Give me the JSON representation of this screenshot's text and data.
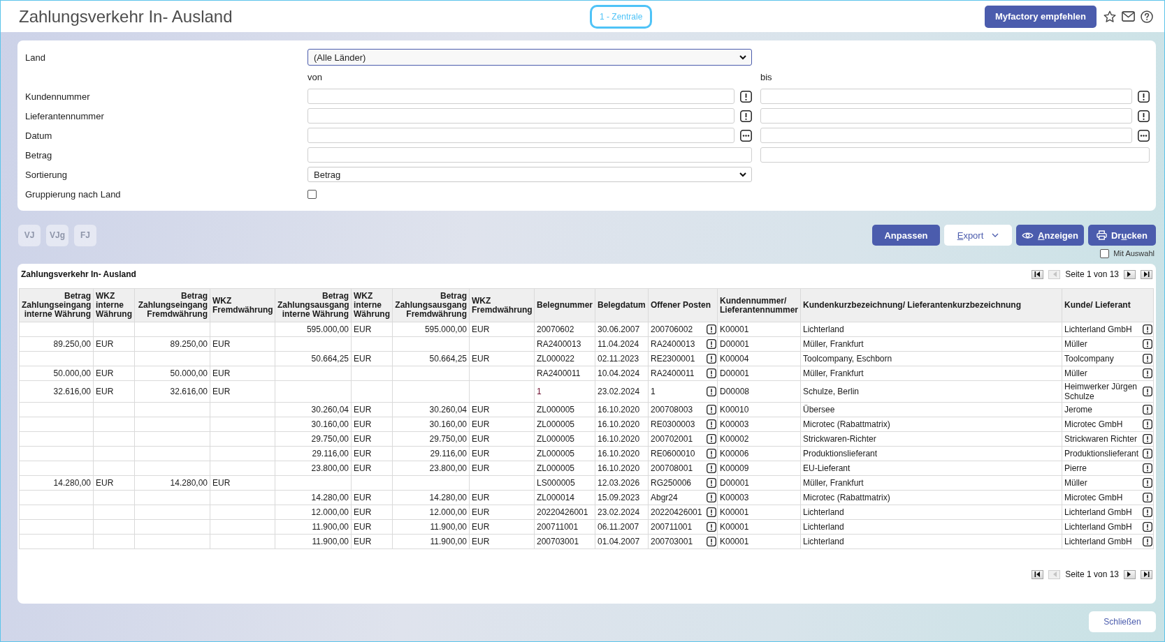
{
  "header": {
    "title": "Zahlungsverkehr In- Ausland",
    "company": "1 - Zentrale",
    "recommend_button": "Myfactory empfehlen"
  },
  "filter": {
    "land": {
      "label": "Land",
      "value": "(Alle Länder)",
      "focused": true
    },
    "range_labels": {
      "from": "von",
      "to": "bis"
    },
    "ranges": [
      {
        "label": "Kundennummer",
        "kind": "lookup"
      },
      {
        "label": "Lieferantennummer",
        "kind": "lookup"
      },
      {
        "label": "Datum",
        "kind": "date"
      },
      {
        "label": "Betrag",
        "kind": "plain"
      }
    ],
    "sort": {
      "label": "Sortierung",
      "value": "Betrag",
      "focused": false
    },
    "grouping": {
      "label": "Gruppierung nach Land",
      "checked": false
    }
  },
  "toolbar": {
    "period_buttons": [
      {
        "label": "VJ",
        "disabled": true
      },
      {
        "label": "VJg",
        "disabled": true
      },
      {
        "label": "FJ",
        "disabled": true
      }
    ],
    "actions": [
      {
        "kind": "primary",
        "label": [
          {
            "text": "Anpassen",
            "underlined": false
          }
        ]
      },
      {
        "kind": "menu",
        "label": [
          {
            "text": "E",
            "underlined": true
          },
          {
            "text": "xport",
            "underlined": false
          }
        ]
      },
      {
        "kind": "view",
        "label": [
          {
            "text": "A",
            "underlined": true
          },
          {
            "text": "nzeigen",
            "underlined": false
          }
        ]
      },
      {
        "kind": "print",
        "label": [
          {
            "text": "Dr",
            "underlined": false
          },
          {
            "text": "u",
            "underlined": true
          },
          {
            "text": "cken",
            "underlined": false
          }
        ]
      }
    ],
    "selection": {
      "label": "Mit Auswahl",
      "checked": false
    }
  },
  "report": {
    "title": "Zahlungsverkehr In- Ausland",
    "pager_top": {
      "text": "Seite 1 von 13",
      "buttons": [
        {
          "kind": "first",
          "disabled": false
        },
        {
          "kind": "previous",
          "disabled": true
        },
        {
          "kind": "next",
          "disabled": false
        },
        {
          "kind": "last",
          "disabled": false
        }
      ]
    },
    "columns": [
      {
        "label": "Betrag Zahlungseingang interne Währung",
        "kind": "amount"
      },
      {
        "label": "WKZ interne Währung",
        "kind": "text"
      },
      {
        "label": "Betrag Zahlungseingang Fremdwährung",
        "kind": "amount"
      },
      {
        "label": "WKZ Fremdwährung",
        "kind": "text"
      },
      {
        "label": "Betrag Zahlungsausgang interne Währung",
        "kind": "amount"
      },
      {
        "label": "WKZ interne Währung",
        "kind": "text"
      },
      {
        "label": "Betrag Zahlungsausgang Fremdwährung",
        "kind": "amount"
      },
      {
        "label": "WKZ Fremdwährung",
        "kind": "text"
      },
      {
        "label": "Belegnummer",
        "kind": "document"
      },
      {
        "label": "Belegdatum",
        "kind": "text"
      },
      {
        "label": "Offener Posten",
        "kind": "lookup"
      },
      {
        "label": "Kundennummer/ Lieferantennummer",
        "kind": "text"
      },
      {
        "label": "Kundenkurzbezeichnung/ Lieferantenkurzbezeichnung",
        "kind": "text"
      },
      {
        "label": "Kunde/ Lieferant",
        "kind": "lookup"
      }
    ],
    "rows": [
      {
        "color": "#1a1a1a",
        "cells": [
          null,
          null,
          null,
          null,
          "595.000,00",
          "EUR",
          "595.000,00",
          "EUR",
          "20070602",
          "30.06.2007",
          "200706002",
          "K00001",
          "Lichterland",
          "Lichterland GmbH"
        ]
      },
      {
        "color": "#1a1a1a",
        "cells": [
          "89.250,00",
          "EUR",
          "89.250,00",
          "EUR",
          null,
          null,
          null,
          null,
          "RA2400013",
          "11.04.2024",
          "RA2400013",
          "D00001",
          "Müller, Frankfurt",
          "Müller"
        ]
      },
      {
        "color": "#1a1a1a",
        "cells": [
          null,
          null,
          null,
          null,
          "50.664,25",
          "EUR",
          "50.664,25",
          "EUR",
          "ZL000022",
          "02.11.2023",
          "RE2300001",
          "K00004",
          "Toolcompany, Eschborn",
          "Toolcompany"
        ]
      },
      {
        "color": "#1a1a1a",
        "cells": [
          "50.000,00",
          "EUR",
          "50.000,00",
          "EUR",
          null,
          null,
          null,
          null,
          "RA2400011",
          "10.04.2024",
          "RA2400011",
          "D00001",
          "Müller, Frankfurt",
          "Müller"
        ]
      },
      {
        "color": "#6e1030",
        "cells": [
          "32.616,00",
          "EUR",
          "32.616,00",
          "EUR",
          null,
          null,
          null,
          null,
          "1",
          "23.02.2024",
          "1",
          "D00008",
          "Schulze, Berlin",
          "Heimwerker Jürgen Schulze"
        ]
      },
      {
        "color": "#1a1a1a",
        "cells": [
          null,
          null,
          null,
          null,
          "30.260,04",
          "EUR",
          "30.260,04",
          "EUR",
          "ZL000005",
          "16.10.2020",
          "200708003",
          "K00010",
          "Übersee",
          "Jerome"
        ]
      },
      {
        "color": "#1a1a1a",
        "cells": [
          null,
          null,
          null,
          null,
          "30.160,00",
          "EUR",
          "30.160,00",
          "EUR",
          "ZL000005",
          "16.10.2020",
          "RE0300003",
          "K00003",
          "Microtec (Rabattmatrix)",
          "Microtec GmbH"
        ]
      },
      {
        "color": "#1a1a1a",
        "cells": [
          null,
          null,
          null,
          null,
          "29.750,00",
          "EUR",
          "29.750,00",
          "EUR",
          "ZL000005",
          "16.10.2020",
          "200702001",
          "K00002",
          "Strickwaren-Richter",
          "Strickwaren Richter"
        ]
      },
      {
        "color": "#1a1a1a",
        "cells": [
          null,
          null,
          null,
          null,
          "29.116,00",
          "EUR",
          "29.116,00",
          "EUR",
          "ZL000005",
          "16.10.2020",
          "RE0600010",
          "K00006",
          "Produktionslieferant",
          "Produktionslieferant"
        ]
      },
      {
        "color": "#1a1a1a",
        "cells": [
          null,
          null,
          null,
          null,
          "23.800,00",
          "EUR",
          "23.800,00",
          "EUR",
          "ZL000005",
          "16.10.2020",
          "200708001",
          "K00009",
          "EU-Lieferant",
          "Pierre"
        ]
      },
      {
        "color": "#1a1a1a",
        "cells": [
          "14.280,00",
          "EUR",
          "14.280,00",
          "EUR",
          null,
          null,
          null,
          null,
          "LS000005",
          "12.03.2026",
          "RG250006",
          "D00001",
          "Müller, Frankfurt",
          "Müller"
        ]
      },
      {
        "color": "#1a1a1a",
        "cells": [
          null,
          null,
          null,
          null,
          "14.280,00",
          "EUR",
          "14.280,00",
          "EUR",
          "ZL000014",
          "15.09.2023",
          "Abgr24",
          "K00003",
          "Microtec (Rabattmatrix)",
          "Microtec GmbH"
        ]
      },
      {
        "color": "#1a1a1a",
        "cells": [
          null,
          null,
          null,
          null,
          "12.000,00",
          "EUR",
          "12.000,00",
          "EUR",
          "20220426001",
          "23.02.2024",
          "20220426001",
          "K00001",
          "Lichterland",
          "Lichterland GmbH"
        ]
      },
      {
        "color": "#1a1a1a",
        "cells": [
          null,
          null,
          null,
          null,
          "11.900,00",
          "EUR",
          "11.900,00",
          "EUR",
          "200711001",
          "06.11.2007",
          "200711001",
          "K00001",
          "Lichterland",
          "Lichterland GmbH"
        ]
      },
      {
        "color": "#1a1a1a",
        "cells": [
          null,
          null,
          null,
          null,
          "11.900,00",
          "EUR",
          "11.900,00",
          "EUR",
          "200703001",
          "01.04.2007",
          "200703001",
          "K00001",
          "Lichterland",
          "Lichterland GmbH"
        ]
      }
    ],
    "pager_bottom": {
      "text": "Seite 1 von 13",
      "buttons": [
        {
          "kind": "first",
          "disabled": false
        },
        {
          "kind": "previous",
          "disabled": true
        },
        {
          "kind": "next",
          "disabled": false
        },
        {
          "kind": "last",
          "disabled": false
        }
      ]
    }
  },
  "footer": {
    "close_button": "Schließen"
  }
}
